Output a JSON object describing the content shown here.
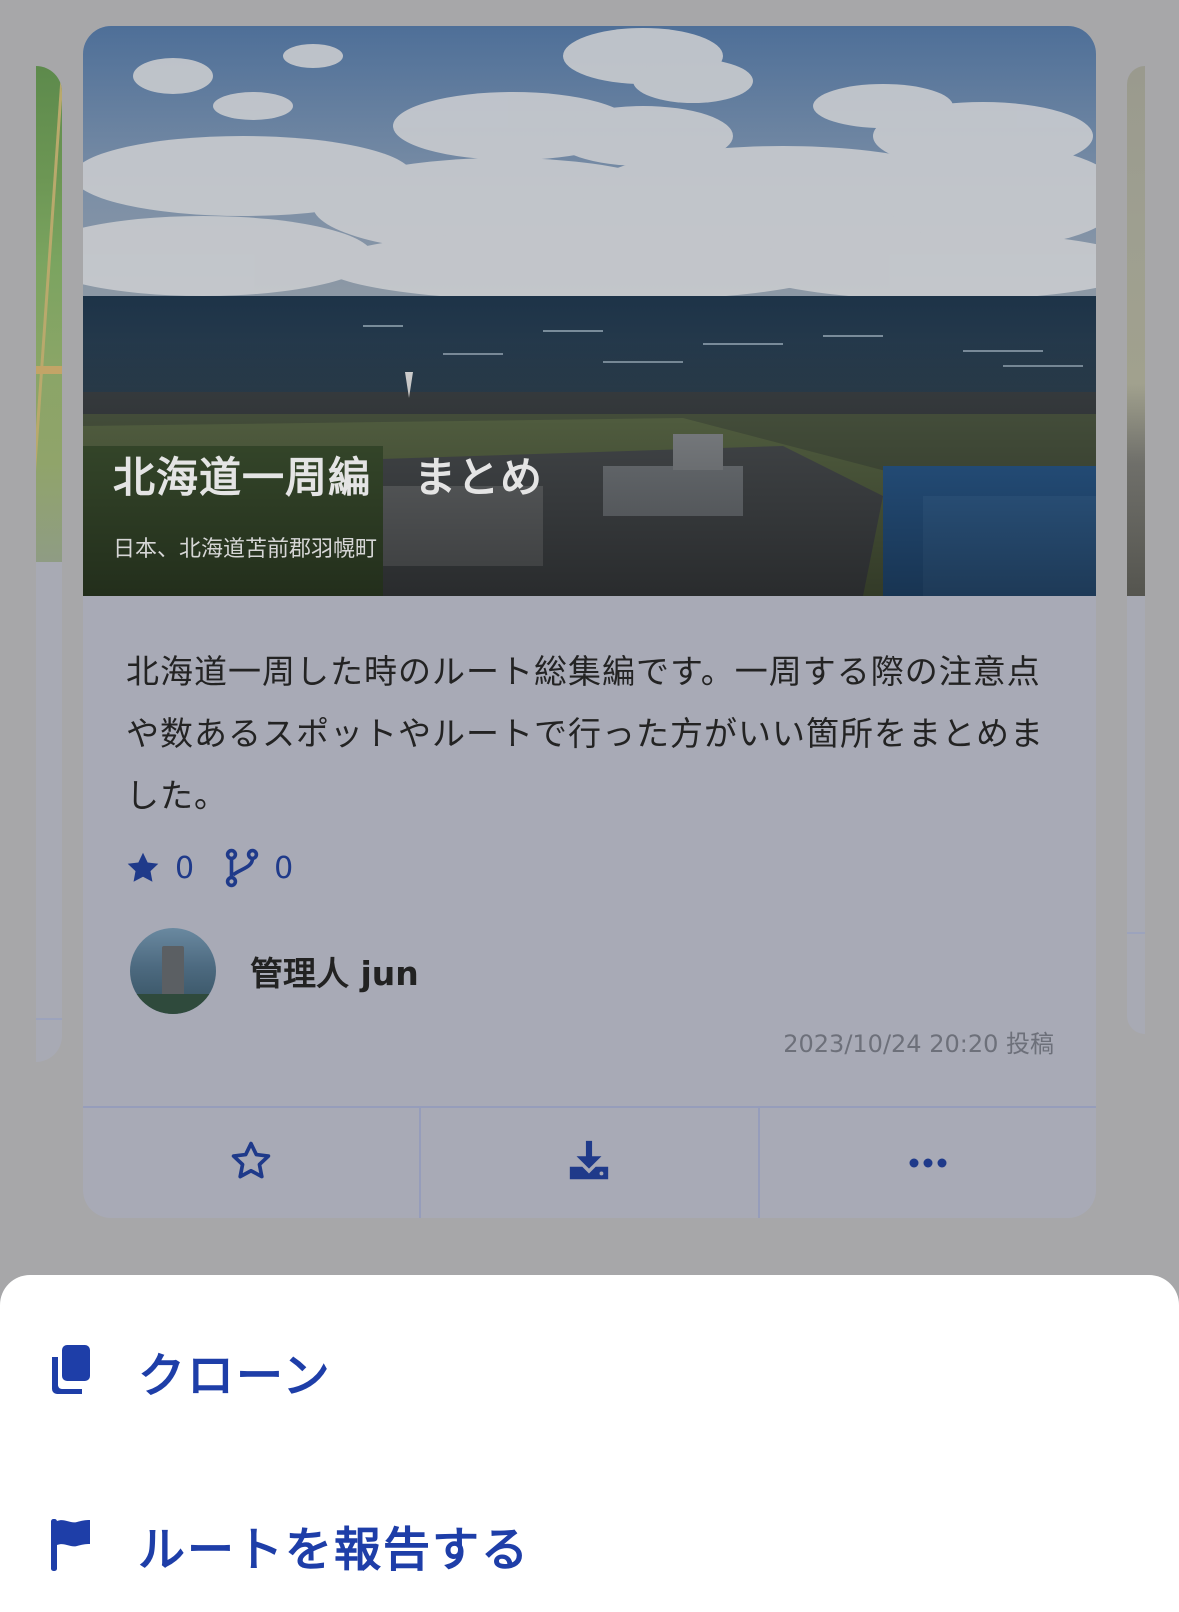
{
  "colors": {
    "accent": "#1e3ea8",
    "icon_blue": "#1f3a8a",
    "overlay": "#a7a7a9",
    "sheet_background": "#ffffff"
  },
  "card": {
    "title": "北海道一周編　まとめ",
    "location": "日本、北海道苫前郡羽幌町",
    "description": "北海道一周した時のルート総集編です。一周する際の注意点や数あるスポットやルートで行った方がいい箇所をまとめました。",
    "stats": {
      "stars_icon": "star-icon",
      "stars": "0",
      "forks_icon": "branch-icon",
      "forks": "0"
    },
    "author": {
      "name": "管理人 jun",
      "avatar": "avatar"
    },
    "posted": "2023/10/24 20:20 投稿",
    "actions": [
      {
        "icon": "star-outline-icon"
      },
      {
        "icon": "download-icon"
      },
      {
        "icon": "more-horizontal-icon"
      }
    ]
  },
  "sheet": {
    "items": [
      {
        "icon": "copy-icon",
        "label": "クローン"
      },
      {
        "icon": "flag-icon",
        "label": "ルートを報告する"
      }
    ]
  }
}
